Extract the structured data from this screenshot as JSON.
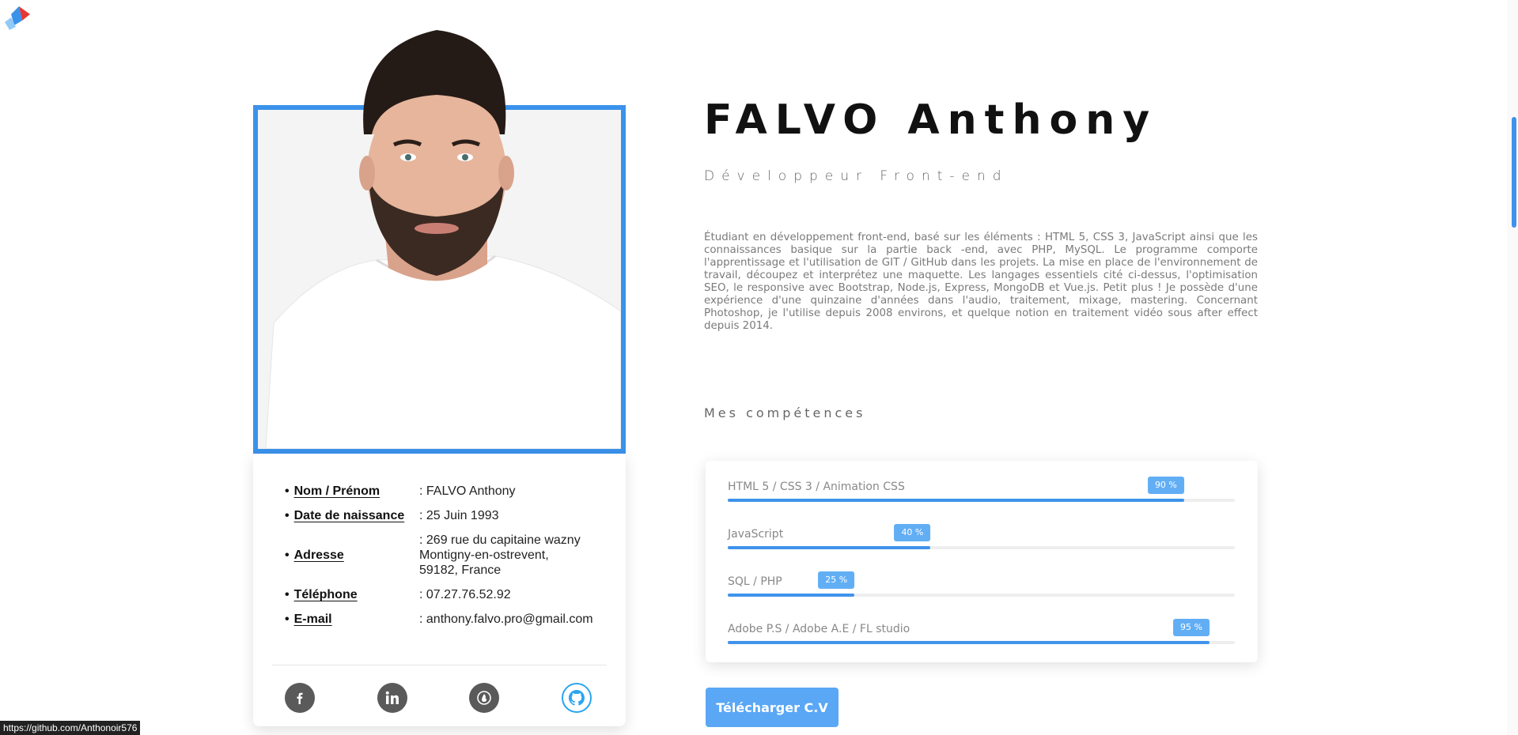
{
  "profile": {
    "name": "FALVO Anthony",
    "role": "Développeur Front-end",
    "bio": "Étudiant en développement front-end, basé sur les éléments : HTML 5, CSS 3, JavaScript ainsi que les connaissances basique sur la partie back -end, avec PHP, MySQL. Le programme comporte l'apprentissage et l'utilisation de GIT / GitHub dans les projets. La mise en place de l'environnement de travail, découpez et interprétez une maquette. Les langages essentiels cité ci-dessus, l'optimisation SEO, le responsive avec Bootstrap, Node.js, Express, MongoDB et Vue.js. Petit plus ! Je possède d'une expérience d'une quinzaine d'années dans l'audio, traitement, mixage, mastering. Concernant Photoshop, je l'utilise depuis 2008 environs, et quelque notion en traitement vidéo sous after effect depuis 2014."
  },
  "info": [
    {
      "key": "Nom / Prénom",
      "value": ": FALVO Anthony"
    },
    {
      "key": "Date de naissance",
      "value": ": 25 Juin 1993"
    },
    {
      "key": "Adresse",
      "value": ": 269 rue du capitaine wazny\nMontigny-en-ostrevent,\n59182, France"
    },
    {
      "key": "Téléphone",
      "value": ": 07.27.76.52.92"
    },
    {
      "key": "E-mail",
      "value": ": anthony.falvo.pro@gmail.com"
    }
  ],
  "skills_title": "Mes compétences",
  "skills": [
    {
      "label": "HTML 5 / CSS 3 / Animation CSS",
      "percent": 90,
      "badge": "90 %"
    },
    {
      "label": "JavaScript",
      "percent": 40,
      "badge": "40 %"
    },
    {
      "label": "SQL / PHP",
      "percent": 25,
      "badge": "25 %"
    },
    {
      "label": "Adobe P.S / Adobe A.E / FL studio",
      "percent": 95,
      "badge": "95 %"
    }
  ],
  "cv_button": "Télécharger C.V",
  "status_url": "https://github.com/Anthonoir576",
  "colors": {
    "accent": "#3f93ea",
    "badge": "#62aef5",
    "button": "#5aa7f5"
  }
}
